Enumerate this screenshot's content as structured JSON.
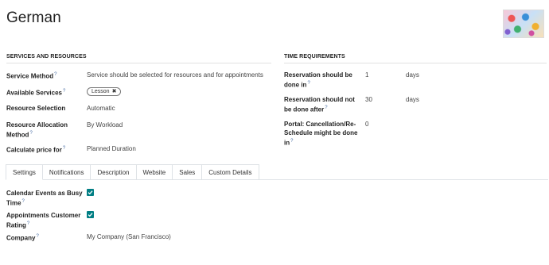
{
  "record": {
    "title": "German"
  },
  "services": {
    "heading": "SERVICES AND RESOURCES",
    "service_method_label": "Service Method",
    "service_method_value": "Service should be selected for resources and for appointments",
    "available_services_label": "Available Services",
    "available_services_tags": [
      "Lesson"
    ],
    "resource_selection_label": "Resource Selection",
    "resource_selection_value": "Automatic",
    "resource_allocation_label_1": "Resource Allocation",
    "resource_allocation_label_2": "Method",
    "resource_allocation_value": "By Workload",
    "calculate_price_label": "Calculate price for",
    "calculate_price_value": "Planned Duration"
  },
  "time": {
    "heading": "TIME REQUIREMENTS",
    "reservation_done_in_label_1": "Reservation should be",
    "reservation_done_in_label_2": "done in",
    "reservation_done_in_value": "1",
    "reservation_done_in_unit": "days",
    "reservation_not_done_label_1": "Reservation should not",
    "reservation_not_done_label_2": "be done after",
    "reservation_not_done_value": "30",
    "reservation_not_done_unit": "days",
    "portal_cancel_label_1": "Portal: Cancellation/Re-",
    "portal_cancel_label_2": "Schedule might be done",
    "portal_cancel_label_3": "in",
    "portal_cancel_value": "0"
  },
  "tabs": [
    "Settings",
    "Notifications",
    "Description",
    "Website",
    "Sales",
    "Custom Details"
  ],
  "settings": {
    "calendar_busy_label_1": "Calendar Events as Busy",
    "calendar_busy_label_2": "Time",
    "calendar_busy_checked": true,
    "customer_rating_label_1": "Appointments Customer",
    "customer_rating_label_2": "Rating",
    "customer_rating_checked": true,
    "company_label": "Company",
    "company_value": "My Company (San Francisco)"
  },
  "help_marker": "?",
  "colors": {
    "accent": "#017e84",
    "help": "#4a6fa5"
  },
  "icons": {
    "tag_remove": "close-icon",
    "checkbox": "check-icon",
    "avatar": "service-image"
  }
}
